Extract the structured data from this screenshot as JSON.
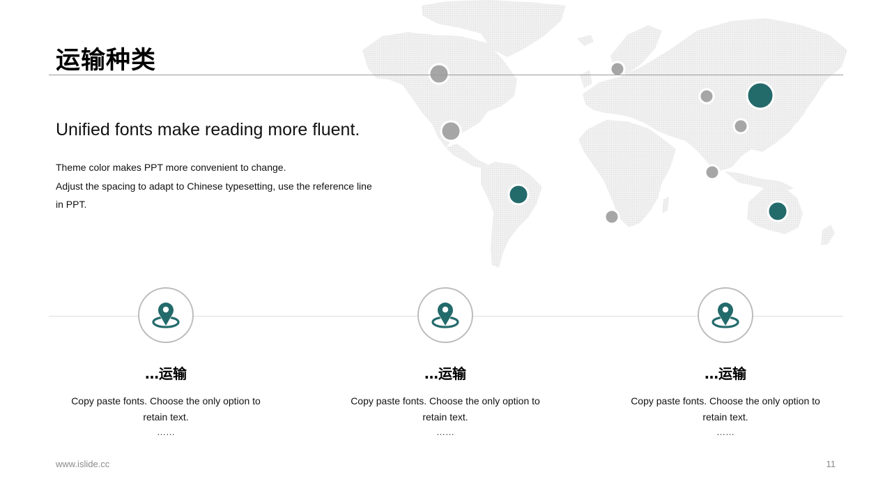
{
  "slide": {
    "title": "运输种类",
    "subtitle": "Unified fonts make reading more fluent.",
    "body_lines": [
      "Theme color makes PPT more convenient  to change.",
      "Adjust the spacing to adapt to Chinese typesetting, use the reference line",
      "in PPT."
    ]
  },
  "items": [
    {
      "title": "…运输",
      "desc_line1": "Copy paste fonts. Choose the only option to",
      "desc_line2": "retain text.",
      "dots": "……",
      "icon": "map-pin-icon"
    },
    {
      "title": "…运输",
      "desc_line1": "Copy paste fonts. Choose the only option to",
      "desc_line2": "retain text.",
      "dots": "……",
      "icon": "map-pin-icon"
    },
    {
      "title": "…运输",
      "desc_line1": "Copy paste fonts. Choose the only option to",
      "desc_line2": "retain text.",
      "dots": "……",
      "icon": "map-pin-icon"
    }
  ],
  "footer": {
    "url": "www.islide.cc",
    "page_number": "11"
  },
  "colors": {
    "accent": "#236a6b",
    "marker_gray": "#a6a6a6",
    "map_fill": "#ededed",
    "rule": "#9a9a9a"
  },
  "map_icon": "world-map"
}
